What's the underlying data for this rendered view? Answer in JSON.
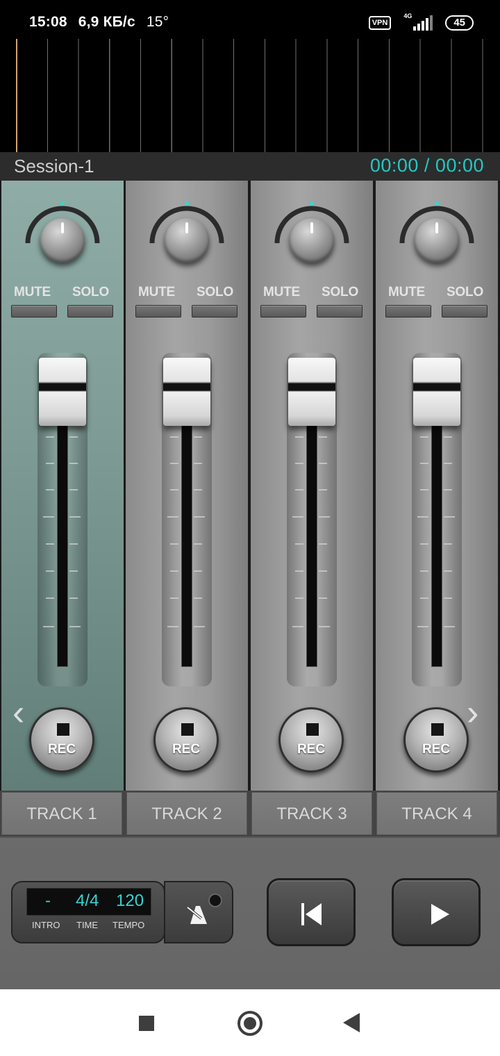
{
  "status_bar": {
    "time": "15:08",
    "network_speed": "6,9 КБ/с",
    "temperature": "15°",
    "vpn": "VPN",
    "network_type": "4G",
    "battery": "45"
  },
  "session": {
    "name": "Session-1",
    "time": "00:00 / 00:00",
    "time_color": "#26c7c4"
  },
  "tracks": [
    {
      "label": "TRACK 1",
      "mute": "MUTE",
      "solo": "SOLO",
      "rec": "REC",
      "active": true
    },
    {
      "label": "TRACK 2",
      "mute": "MUTE",
      "solo": "SOLO",
      "rec": "REC",
      "active": false
    },
    {
      "label": "TRACK 3",
      "mute": "MUTE",
      "solo": "SOLO",
      "rec": "REC",
      "active": false
    },
    {
      "label": "TRACK 4",
      "mute": "MUTE",
      "solo": "SOLO",
      "rec": "REC",
      "active": false
    }
  ],
  "transport": {
    "intro_value": "-",
    "time_value": "4/4",
    "tempo_value": "120",
    "intro_label": "INTRO",
    "time_label": "TIME",
    "tempo_label": "TEMPO",
    "metronome_icon": "metronome-icon",
    "rewind_icon": "skip-to-start-icon",
    "play_icon": "play-icon"
  },
  "colors": {
    "accent": "#37d4d0",
    "active_strip": "#7f9c96",
    "playhead": "#d9a36c"
  }
}
